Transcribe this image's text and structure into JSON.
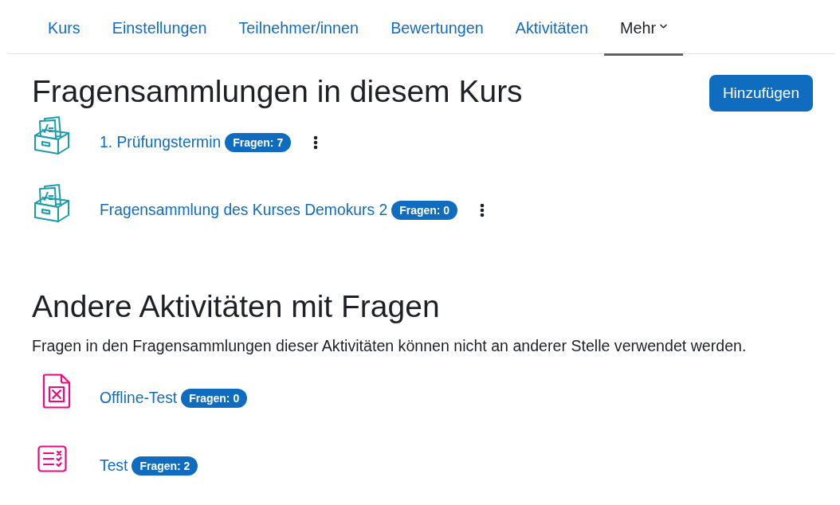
{
  "tabs": [
    {
      "label": "Kurs",
      "selected": false,
      "kind": "link"
    },
    {
      "label": "Einstellungen",
      "selected": false,
      "kind": "link"
    },
    {
      "label": "Teilnehmer/innen",
      "selected": false,
      "kind": "link"
    },
    {
      "label": "Bewertungen",
      "selected": false,
      "kind": "link"
    },
    {
      "label": "Aktivitäten",
      "selected": false,
      "kind": "link"
    },
    {
      "label": "Mehr",
      "selected": true,
      "kind": "menu"
    }
  ],
  "course_banks": {
    "title": "Fragensammlungen in diesem Kurs",
    "add_button": "Hinzufügen",
    "items": [
      {
        "name": "1. Prüfungstermin",
        "badge": "Fragen: 7"
      },
      {
        "name": "Fragensammlung des Kurses Demokurs 2",
        "badge": "Fragen: 0"
      }
    ]
  },
  "other_activities": {
    "title": "Andere Aktivitäten mit Fragen",
    "description": "Fragen in den Fragensammlungen dieser Aktivitäten können nicht an anderer Stelle verwendet werden.",
    "items": [
      {
        "kind": "offline_quiz",
        "name": "Offline-Test",
        "badge": "Fragen: 0"
      },
      {
        "kind": "quiz",
        "name": "Test",
        "badge": "Fragen: 2"
      }
    ]
  }
}
